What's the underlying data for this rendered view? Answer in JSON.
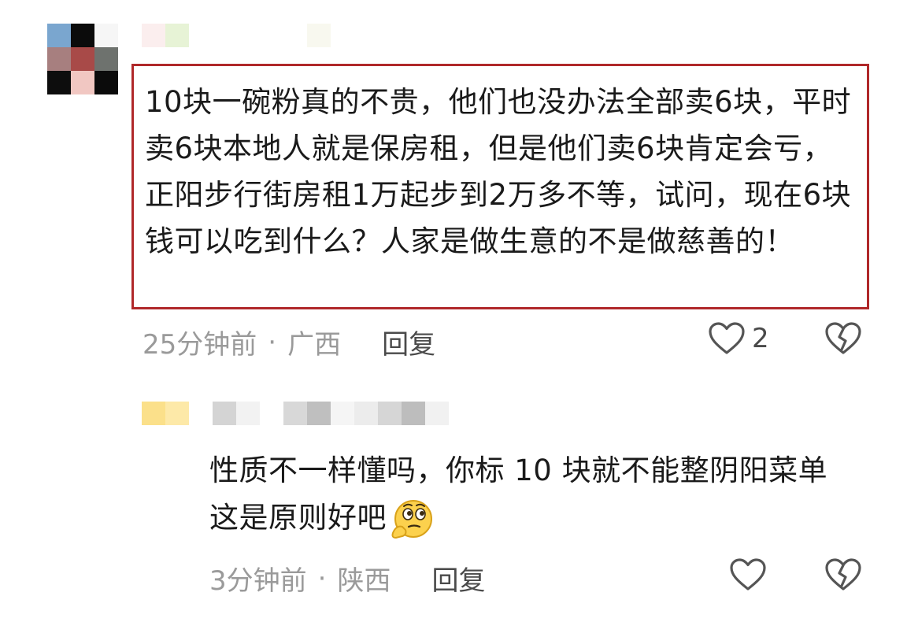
{
  "comment": {
    "text": "10块一碗粉真的不贵，他们也没办法全部卖6块，平时卖6块本地人就是保房租，但是他们卖6块肯定会亏，正阳步行街房租1万起步到2万多不等，试问，现在6块钱可以吃到什么？人家是做生意的不是做慈善的！",
    "time": "25分钟前",
    "location": "广西",
    "separator": "·",
    "reply_label": "回复",
    "like_count": "2",
    "like_icon": "heart-outline-icon",
    "dislike_icon": "broken-heart-icon",
    "highlight_color": "#b0282a"
  },
  "reply": {
    "text": "性质不一样懂吗，你标 10 块就不能整阴阳菜单这是原则好吧",
    "emoji": "thinking-face-emoji",
    "time": "3分钟前",
    "location": "陕西",
    "separator": "·",
    "reply_label": "回复",
    "like_icon": "heart-outline-icon",
    "dislike_icon": "broken-heart-icon"
  }
}
